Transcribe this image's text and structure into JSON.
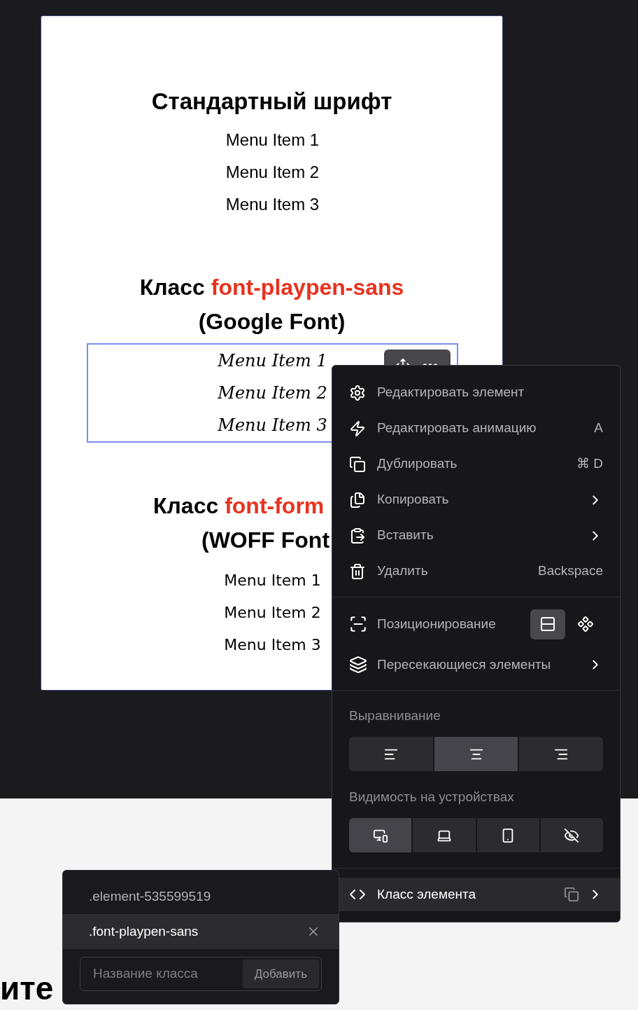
{
  "card": {
    "sections": [
      {
        "kind": "standard",
        "title": "Стандартный шрифт",
        "selected": false,
        "items": [
          "Menu Item 1",
          "Menu Item 2",
          "Menu Item 3"
        ]
      },
      {
        "kind": "playpen",
        "title": "Класс",
        "class_name": "font-playpen-sans",
        "subtitle": "(Google Font)",
        "selected": true,
        "items": [
          "Menu Item 1",
          "Menu Item 2",
          "Menu Item 3"
        ]
      },
      {
        "kind": "woff",
        "title": "Класс",
        "class_name": "font-form",
        "subtitle": "(WOFF Font",
        "selected": false,
        "items": [
          "Menu Item 1",
          "Menu Item 2",
          "Menu Item 3"
        ]
      }
    ]
  },
  "context_menu": {
    "items": [
      {
        "label": "Редактировать элемент",
        "submenu": false
      },
      {
        "label": "Редактировать анимацию",
        "shortcut": "A",
        "submenu": false
      },
      {
        "label": "Дублировать",
        "shortcut": "⌘ D",
        "submenu": false
      },
      {
        "label": "Копировать",
        "submenu": true
      },
      {
        "label": "Вставить",
        "submenu": true
      },
      {
        "label": "Удалить",
        "shortcut": "Backspace",
        "submenu": false
      }
    ],
    "positioning": {
      "label": "Позиционирование",
      "options": [
        {
          "selected": true
        },
        {
          "selected": false
        }
      ]
    },
    "intersecting": {
      "label": "Пересекающиеся элементы",
      "submenu": true
    },
    "alignment": {
      "label": "Выравнивание",
      "options": [
        {
          "selected": false
        },
        {
          "selected": true
        },
        {
          "selected": false
        }
      ]
    },
    "visibility": {
      "label": "Видимость на устройствах",
      "options": [
        {
          "selected": true
        },
        {
          "selected": false
        },
        {
          "selected": false
        },
        {
          "selected": false
        }
      ]
    },
    "element_class": {
      "label": "Класс элемента",
      "selected": true,
      "submenu": true
    }
  },
  "class_popup": {
    "classes": [
      {
        "name": ".element-535599519",
        "selected": false,
        "removable": false
      },
      {
        "name": ".font-playpen-sans",
        "selected": true,
        "removable": true
      }
    ],
    "input": {
      "placeholder": "Название класса"
    },
    "add_button": "Добавить"
  },
  "page_text": "ите"
}
